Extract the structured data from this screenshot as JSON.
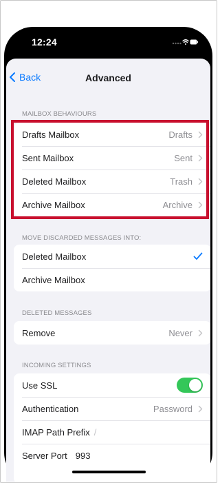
{
  "status_bar": {
    "time": "12:24"
  },
  "nav": {
    "back_label": "Back",
    "title": "Advanced"
  },
  "sections": [
    {
      "header": "MAILBOX BEHAVIOURS",
      "rows": [
        {
          "label": "Drafts Mailbox",
          "value": "Drafts"
        },
        {
          "label": "Sent Mailbox",
          "value": "Sent"
        },
        {
          "label": "Deleted Mailbox",
          "value": "Trash"
        },
        {
          "label": "Archive Mailbox",
          "value": "Archive"
        }
      ]
    },
    {
      "header": "MOVE DISCARDED MESSAGES INTO:",
      "rows": [
        {
          "label": "Deleted Mailbox",
          "selected": true
        },
        {
          "label": "Archive Mailbox",
          "selected": false
        }
      ]
    },
    {
      "header": "DELETED MESSAGES",
      "rows": [
        {
          "label": "Remove",
          "value": "Never"
        }
      ]
    },
    {
      "header": "INCOMING SETTINGS",
      "rows": [
        {
          "label": "Use SSL",
          "toggle_on": true
        },
        {
          "label": "Authentication",
          "value": "Password"
        },
        {
          "label": "IMAP Path Prefix",
          "value": "/"
        },
        {
          "label": "Server Port",
          "value": "993"
        }
      ]
    }
  ],
  "colors": {
    "accent": "#0a7aff",
    "toggle_on": "#34c759",
    "highlight_border": "#c8102e",
    "background": "#f2f2f7"
  }
}
